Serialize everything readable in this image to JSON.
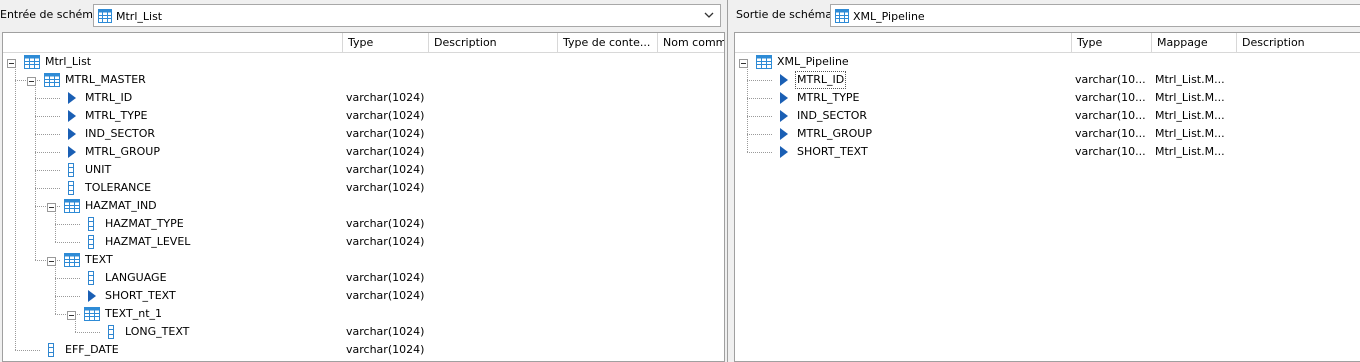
{
  "left": {
    "label": "Entrée de schéma :",
    "combo_value": "Mtrl_List",
    "columns": [
      "Type",
      "Description",
      "Type de conte...",
      "Nom comm"
    ],
    "rows": [
      {
        "name": "Mtrl_List",
        "type": "",
        "icon": "table-icon",
        "level": 0,
        "expander": "minus"
      },
      {
        "name": "MTRL_MASTER",
        "type": "",
        "icon": "table-icon",
        "level": 1,
        "expander": "minus"
      },
      {
        "name": "MTRL_ID",
        "type": "varchar(1024)",
        "icon": "key-field-icon",
        "level": 2,
        "expander": ""
      },
      {
        "name": "MTRL_TYPE",
        "type": "varchar(1024)",
        "icon": "key-field-icon",
        "level": 2,
        "expander": ""
      },
      {
        "name": "IND_SECTOR",
        "type": "varchar(1024)",
        "icon": "key-field-icon",
        "level": 2,
        "expander": ""
      },
      {
        "name": "MTRL_GROUP",
        "type": "varchar(1024)",
        "icon": "key-field-icon",
        "level": 2,
        "expander": ""
      },
      {
        "name": "UNIT",
        "type": "varchar(1024)",
        "icon": "field-icon",
        "level": 2,
        "expander": ""
      },
      {
        "name": "TOLERANCE",
        "type": "varchar(1024)",
        "icon": "field-icon",
        "level": 2,
        "expander": ""
      },
      {
        "name": "HAZMAT_IND",
        "type": "",
        "icon": "table-icon",
        "level": 2,
        "expander": "minus"
      },
      {
        "name": "HAZMAT_TYPE",
        "type": "varchar(1024)",
        "icon": "field-icon",
        "level": 3,
        "expander": ""
      },
      {
        "name": "HAZMAT_LEVEL",
        "type": "varchar(1024)",
        "icon": "field-icon",
        "level": 3,
        "expander": ""
      },
      {
        "name": "TEXT",
        "type": "",
        "icon": "table-icon",
        "level": 2,
        "expander": "minus"
      },
      {
        "name": "LANGUAGE",
        "type": "varchar(1024)",
        "icon": "field-icon",
        "level": 3,
        "expander": ""
      },
      {
        "name": "SHORT_TEXT",
        "type": "varchar(1024)",
        "icon": "key-field-icon",
        "level": 3,
        "expander": ""
      },
      {
        "name": "TEXT_nt_1",
        "type": "",
        "icon": "table-icon",
        "level": 3,
        "expander": "minus"
      },
      {
        "name": "LONG_TEXT",
        "type": "varchar(1024)",
        "icon": "field-icon",
        "level": 4,
        "expander": ""
      },
      {
        "name": "EFF_DATE",
        "type": "varchar(1024)",
        "icon": "field-icon",
        "level": 1,
        "expander": ""
      }
    ]
  },
  "right": {
    "label": "Sortie de schéma :",
    "combo_value": "XML_Pipeline",
    "columns": [
      "Type",
      "Mappage",
      "Description"
    ],
    "rows": [
      {
        "name": "XML_Pipeline",
        "type": "",
        "mapping": "",
        "icon": "table-icon",
        "level": 0,
        "expander": "minus"
      },
      {
        "name": "MTRL_ID",
        "type": "varchar(10...",
        "mapping": "Mtrl_List.M...",
        "icon": "key-field-icon",
        "level": 1,
        "expander": "",
        "selected": true
      },
      {
        "name": "MTRL_TYPE",
        "type": "varchar(10...",
        "mapping": "Mtrl_List.M...",
        "icon": "key-field-icon",
        "level": 1,
        "expander": ""
      },
      {
        "name": "IND_SECTOR",
        "type": "varchar(10...",
        "mapping": "Mtrl_List.M...",
        "icon": "key-field-icon",
        "level": 1,
        "expander": ""
      },
      {
        "name": "MTRL_GROUP",
        "type": "varchar(10...",
        "mapping": "Mtrl_List.M...",
        "icon": "key-field-icon",
        "level": 1,
        "expander": ""
      },
      {
        "name": "SHORT_TEXT",
        "type": "varchar(10...",
        "mapping": "Mtrl_List.M...",
        "icon": "key-field-icon",
        "level": 1,
        "expander": ""
      }
    ]
  },
  "colors": {
    "key_arrow": "#1a5fb4",
    "table_blue": "#2e8bd6",
    "field_blue": "#2f86d0"
  }
}
